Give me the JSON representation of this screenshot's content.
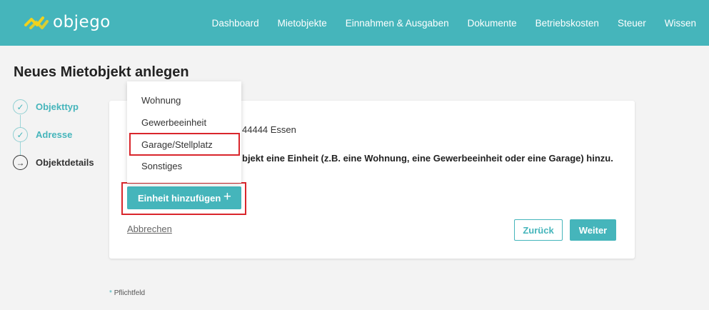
{
  "app": {
    "logo_text": "objego",
    "brand_color": "#45b5bb",
    "highlight_color": "#d9262c"
  },
  "nav": {
    "items": [
      "Dashboard",
      "Mietobjekte",
      "Einnahmen & Ausgaben",
      "Dokumente",
      "Betriebskosten",
      "Steuer",
      "Wissen"
    ]
  },
  "page": {
    "title": "Neues Mietobjekt anlegen"
  },
  "steps": [
    {
      "label": "Objekttyp",
      "state": "done",
      "icon": "check-icon"
    },
    {
      "label": "Adresse",
      "state": "done",
      "icon": "check-icon"
    },
    {
      "label": "Objektdetails",
      "state": "current",
      "icon": "arrow-right-icon"
    }
  ],
  "card": {
    "address": "44444 Essen",
    "info_text": "bjekt eine Einheit (z.B. eine Wohnung, eine Gewerbeeinheit oder eine Garage) hinzu.",
    "add_button": "Einheit hinzufügen",
    "cancel_link": "Abbrechen",
    "back_button": "Zurück",
    "next_button": "Weiter"
  },
  "dropdown": {
    "options": [
      "Wohnung",
      "Gewerbeeinheit",
      "Garage/Stellplatz",
      "Sonstiges"
    ],
    "highlighted": "Garage/Stellplatz"
  },
  "footer": {
    "required_marker": "*",
    "required_note": "Pflichtfeld"
  }
}
